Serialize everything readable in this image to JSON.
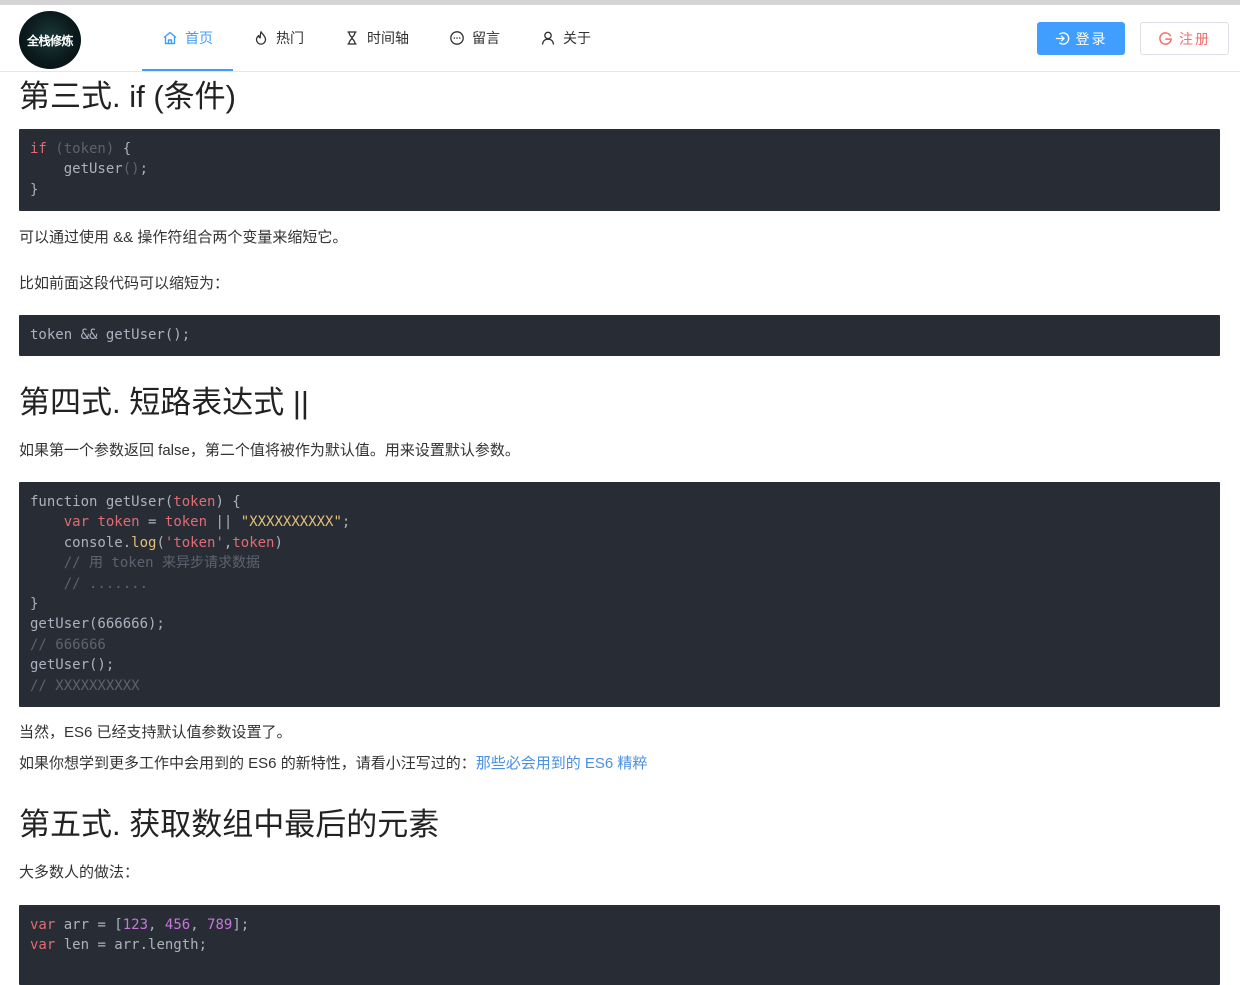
{
  "header": {
    "logo_text": "全栈修炼",
    "nav": [
      {
        "label": "首页",
        "icon": "home-icon",
        "active": true
      },
      {
        "label": "热门",
        "icon": "fire-icon"
      },
      {
        "label": "时间轴",
        "icon": "hourglass-icon"
      },
      {
        "label": "留言",
        "icon": "chat-icon"
      },
      {
        "label": "关于",
        "icon": "user-icon"
      }
    ],
    "login_label": "登录",
    "register_label": "注册"
  },
  "colors": {
    "accent": "#409eff",
    "danger": "#f56c6c",
    "code_bg": "#282c34",
    "link": "#4a90e2"
  },
  "article": {
    "s3_title": "第三式. if (条件)",
    "s3_code": {
      "l1_kw": "if",
      "l1_cond": " (token) ",
      "l1_brace": "{",
      "l2_fn": "getUser",
      "l2_paren": "()",
      "l2_semi": ";",
      "l3": "}"
    },
    "s3_p1": "可以通过使用 && 操作符组合两个变量来缩短它。",
    "s3_p2": "比如前面这段代码可以缩短为：",
    "s3_code2": "token && getUser();",
    "s4_title": "第四式. 短路表达式 ||",
    "s4_p1": "如果第一个参数返回 false，第二个值将被作为默认值。用来设置默认参数。",
    "s4_code": {
      "l1_a": "function getUser(",
      "l1_b": "token",
      "l1_c": ") {",
      "l2_a": "var",
      "l2_b": " token",
      "l2_c": " = ",
      "l2_d": "token",
      "l2_e": " || ",
      "l2_f": "\"XXXXXXXXXX\"",
      "l2_g": ";",
      "l3_a": "console.",
      "l3_b": "log",
      "l3_c": "(",
      "l3_d": "'token'",
      "l3_e": ",",
      "l3_f": "token",
      "l3_g": ")",
      "l4": "// 用 token 来异步请求数据",
      "l5": "// .......",
      "l6": "}",
      "l7": "getUser(666666);",
      "l8": "// 666666",
      "l9": "getUser();",
      "l10": "// XXXXXXXXXX"
    },
    "s4_p2": "当然，ES6 已经支持默认值参数设置了。",
    "s4_p3": "如果你想学到更多工作中会用到的 ES6 的新特性，请看小汪写过的：",
    "s4_link": "那些必会用到的 ES6 精粹",
    "s5_title": "第五式. 获取数组中最后的元素",
    "s5_p1": "大多数人的做法：",
    "s5_code": {
      "l1_kw": "var",
      "l1_a": " arr = [",
      "l1_n1": "123",
      "l1_s1": ", ",
      "l1_n2": "456",
      "l1_s2": ", ",
      "l1_n3": "789",
      "l1_e": "];",
      "l2_kw": "var",
      "l2_a": " len = arr.length;"
    }
  }
}
